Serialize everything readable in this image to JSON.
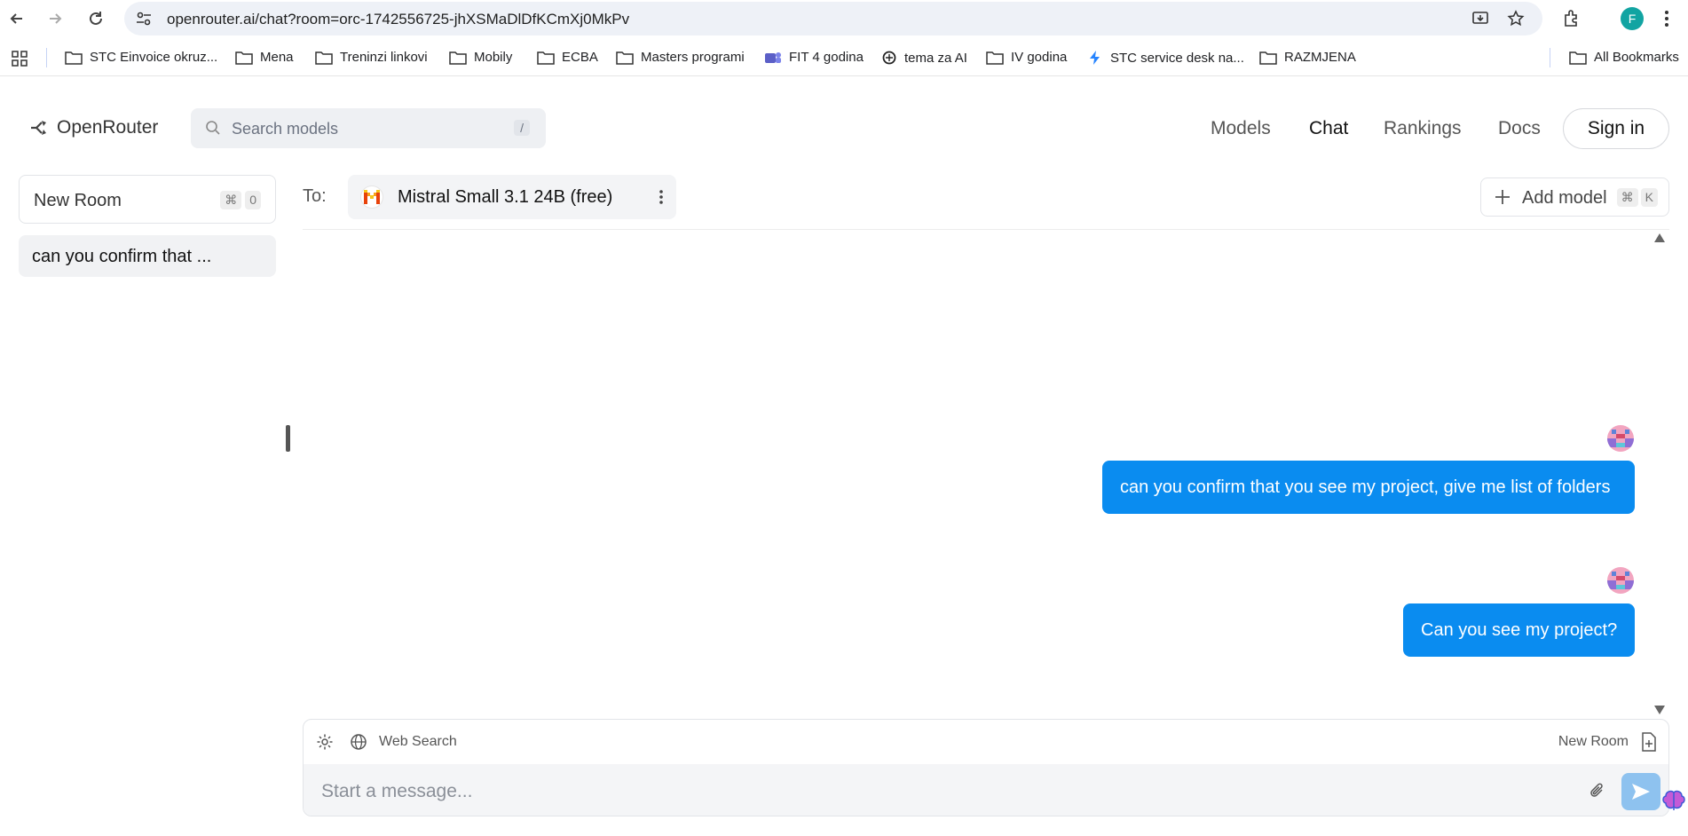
{
  "browser": {
    "url": "openrouter.ai/chat?room=orc-1742556725-jhXSMaDlDfKCmXj0MkPv",
    "profile_initial": "F",
    "bookmarks": [
      {
        "label": "STC Einvoice okruz...",
        "icon": "folder-icon"
      },
      {
        "label": "Mena",
        "icon": "folder-icon"
      },
      {
        "label": "Treninzi linkovi",
        "icon": "folder-icon"
      },
      {
        "label": "Mobily",
        "icon": "folder-icon"
      },
      {
        "label": "ECBA",
        "icon": "folder-icon"
      },
      {
        "label": "Masters programi",
        "icon": "folder-icon"
      },
      {
        "label": "FIT 4 godina",
        "icon": "teams-icon"
      },
      {
        "label": "tema za AI",
        "icon": "openai-icon"
      },
      {
        "label": "IV godina",
        "icon": "folder-icon"
      },
      {
        "label": "STC service desk na...",
        "icon": "jira-icon"
      },
      {
        "label": "RAZMJENA",
        "icon": "folder-icon"
      }
    ],
    "all_bookmarks": "All Bookmarks"
  },
  "header": {
    "brand": "OpenRouter",
    "search_placeholder": "Search models",
    "search_shortcut": "/",
    "nav": [
      "Models",
      "Chat",
      "Rankings",
      "Docs"
    ],
    "active_nav": "Chat",
    "signin": "Sign in"
  },
  "sidebar": {
    "new_room": "New Room",
    "new_room_keys": [
      "⌘",
      "0"
    ],
    "rooms": [
      "can you confirm that ..."
    ]
  },
  "modelbar": {
    "to_label": "To:",
    "model_name": "Mistral Small 3.1 24B (free)",
    "add_model": "Add model",
    "add_model_keys": [
      "⌘",
      "K"
    ]
  },
  "messages": [
    {
      "role": "user",
      "text": "can you confirm that you see my project, give me list of folders"
    },
    {
      "role": "user",
      "text": "Can you see my project?"
    }
  ],
  "composer": {
    "web_search": "Web Search",
    "new_room": "New Room",
    "placeholder": "Start a message..."
  },
  "colors": {
    "bubble": "#0a8cf0",
    "send_button": "#8ec2ef",
    "profile": "#12a4a2"
  }
}
